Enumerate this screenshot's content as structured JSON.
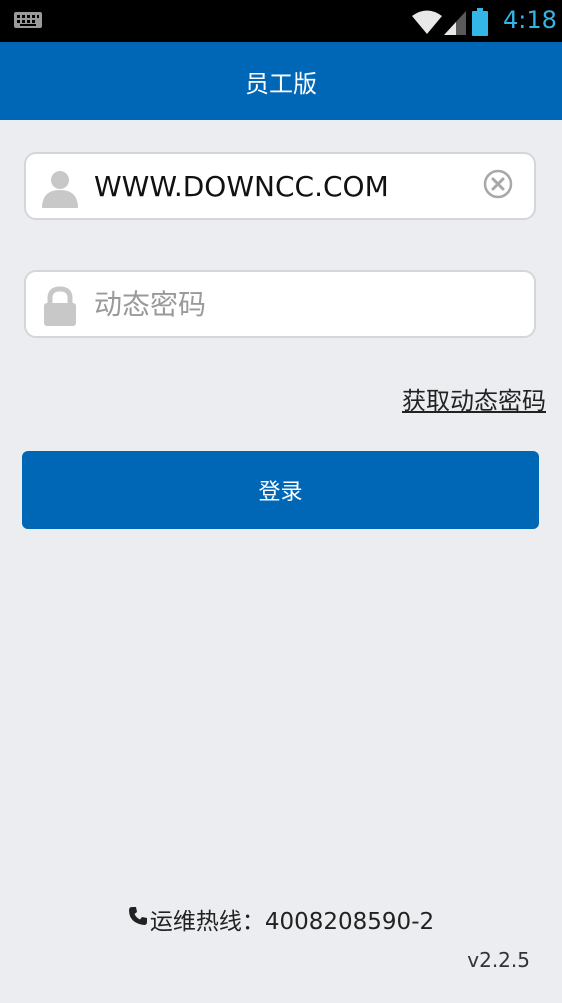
{
  "status_bar": {
    "time": "4:18",
    "keyboard_icon": "keyboard-icon",
    "wifi_icon": "wifi-icon",
    "signal_icon": "cell-signal-icon",
    "battery_icon": "battery-icon",
    "accent_color": "#33b5e5"
  },
  "header": {
    "title": "员工版",
    "color": "#0067b7"
  },
  "form": {
    "username": {
      "value": "WWW.DOWNCC.COM",
      "icon": "user-icon",
      "clear_icon": "clear-icon"
    },
    "password": {
      "placeholder": "动态密码",
      "icon": "lock-icon"
    },
    "get_code_link": "获取动态密码",
    "login_label": "登录"
  },
  "footer": {
    "hotline": "运维热线：4008208590-2",
    "phone_icon": "phone-icon",
    "version": "v2.2.5"
  }
}
